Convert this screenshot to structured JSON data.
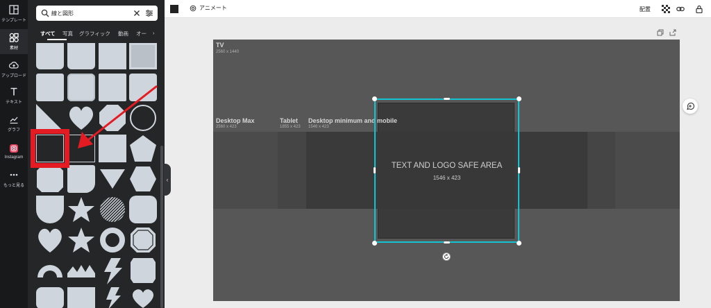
{
  "rail": {
    "items": [
      {
        "label": "テンプレート",
        "icon": "template-icon"
      },
      {
        "label": "素材",
        "icon": "elements-icon"
      },
      {
        "label": "アップロード",
        "icon": "upload-icon"
      },
      {
        "label": "テキスト",
        "icon": "text-icon"
      },
      {
        "label": "グラフ",
        "icon": "chart-icon"
      },
      {
        "label": "Instagram",
        "icon": "instagram-icon"
      },
      {
        "label": "もっと見る",
        "icon": "more-icon"
      }
    ]
  },
  "search": {
    "value": "線と図形"
  },
  "tabs": [
    "すべて",
    "写真",
    "グラフィック",
    "動画",
    "オー"
  ],
  "topbar": {
    "animate_label": "アニメート",
    "align_label": "配置",
    "color_swatch": "#222222"
  },
  "canvas": {
    "tv_title": "TV",
    "tv_dims": "2560 x 1440",
    "desktop_max_title": "Desktop Max",
    "desktop_max_dims": "2560 x 423",
    "tablet_title": "Tablet",
    "tablet_dims": "1855 x 423",
    "desktop_min_title": "Desktop minimum and mobile",
    "desktop_min_dims": "1546 x 423",
    "safe_area_title": "TEXT AND LOGO SAFE AREA",
    "safe_area_dims": "1546 x 423"
  },
  "colors": {
    "selection": "#13c4d2",
    "highlight": "#e51b23",
    "shape": "#cfd5dc"
  }
}
